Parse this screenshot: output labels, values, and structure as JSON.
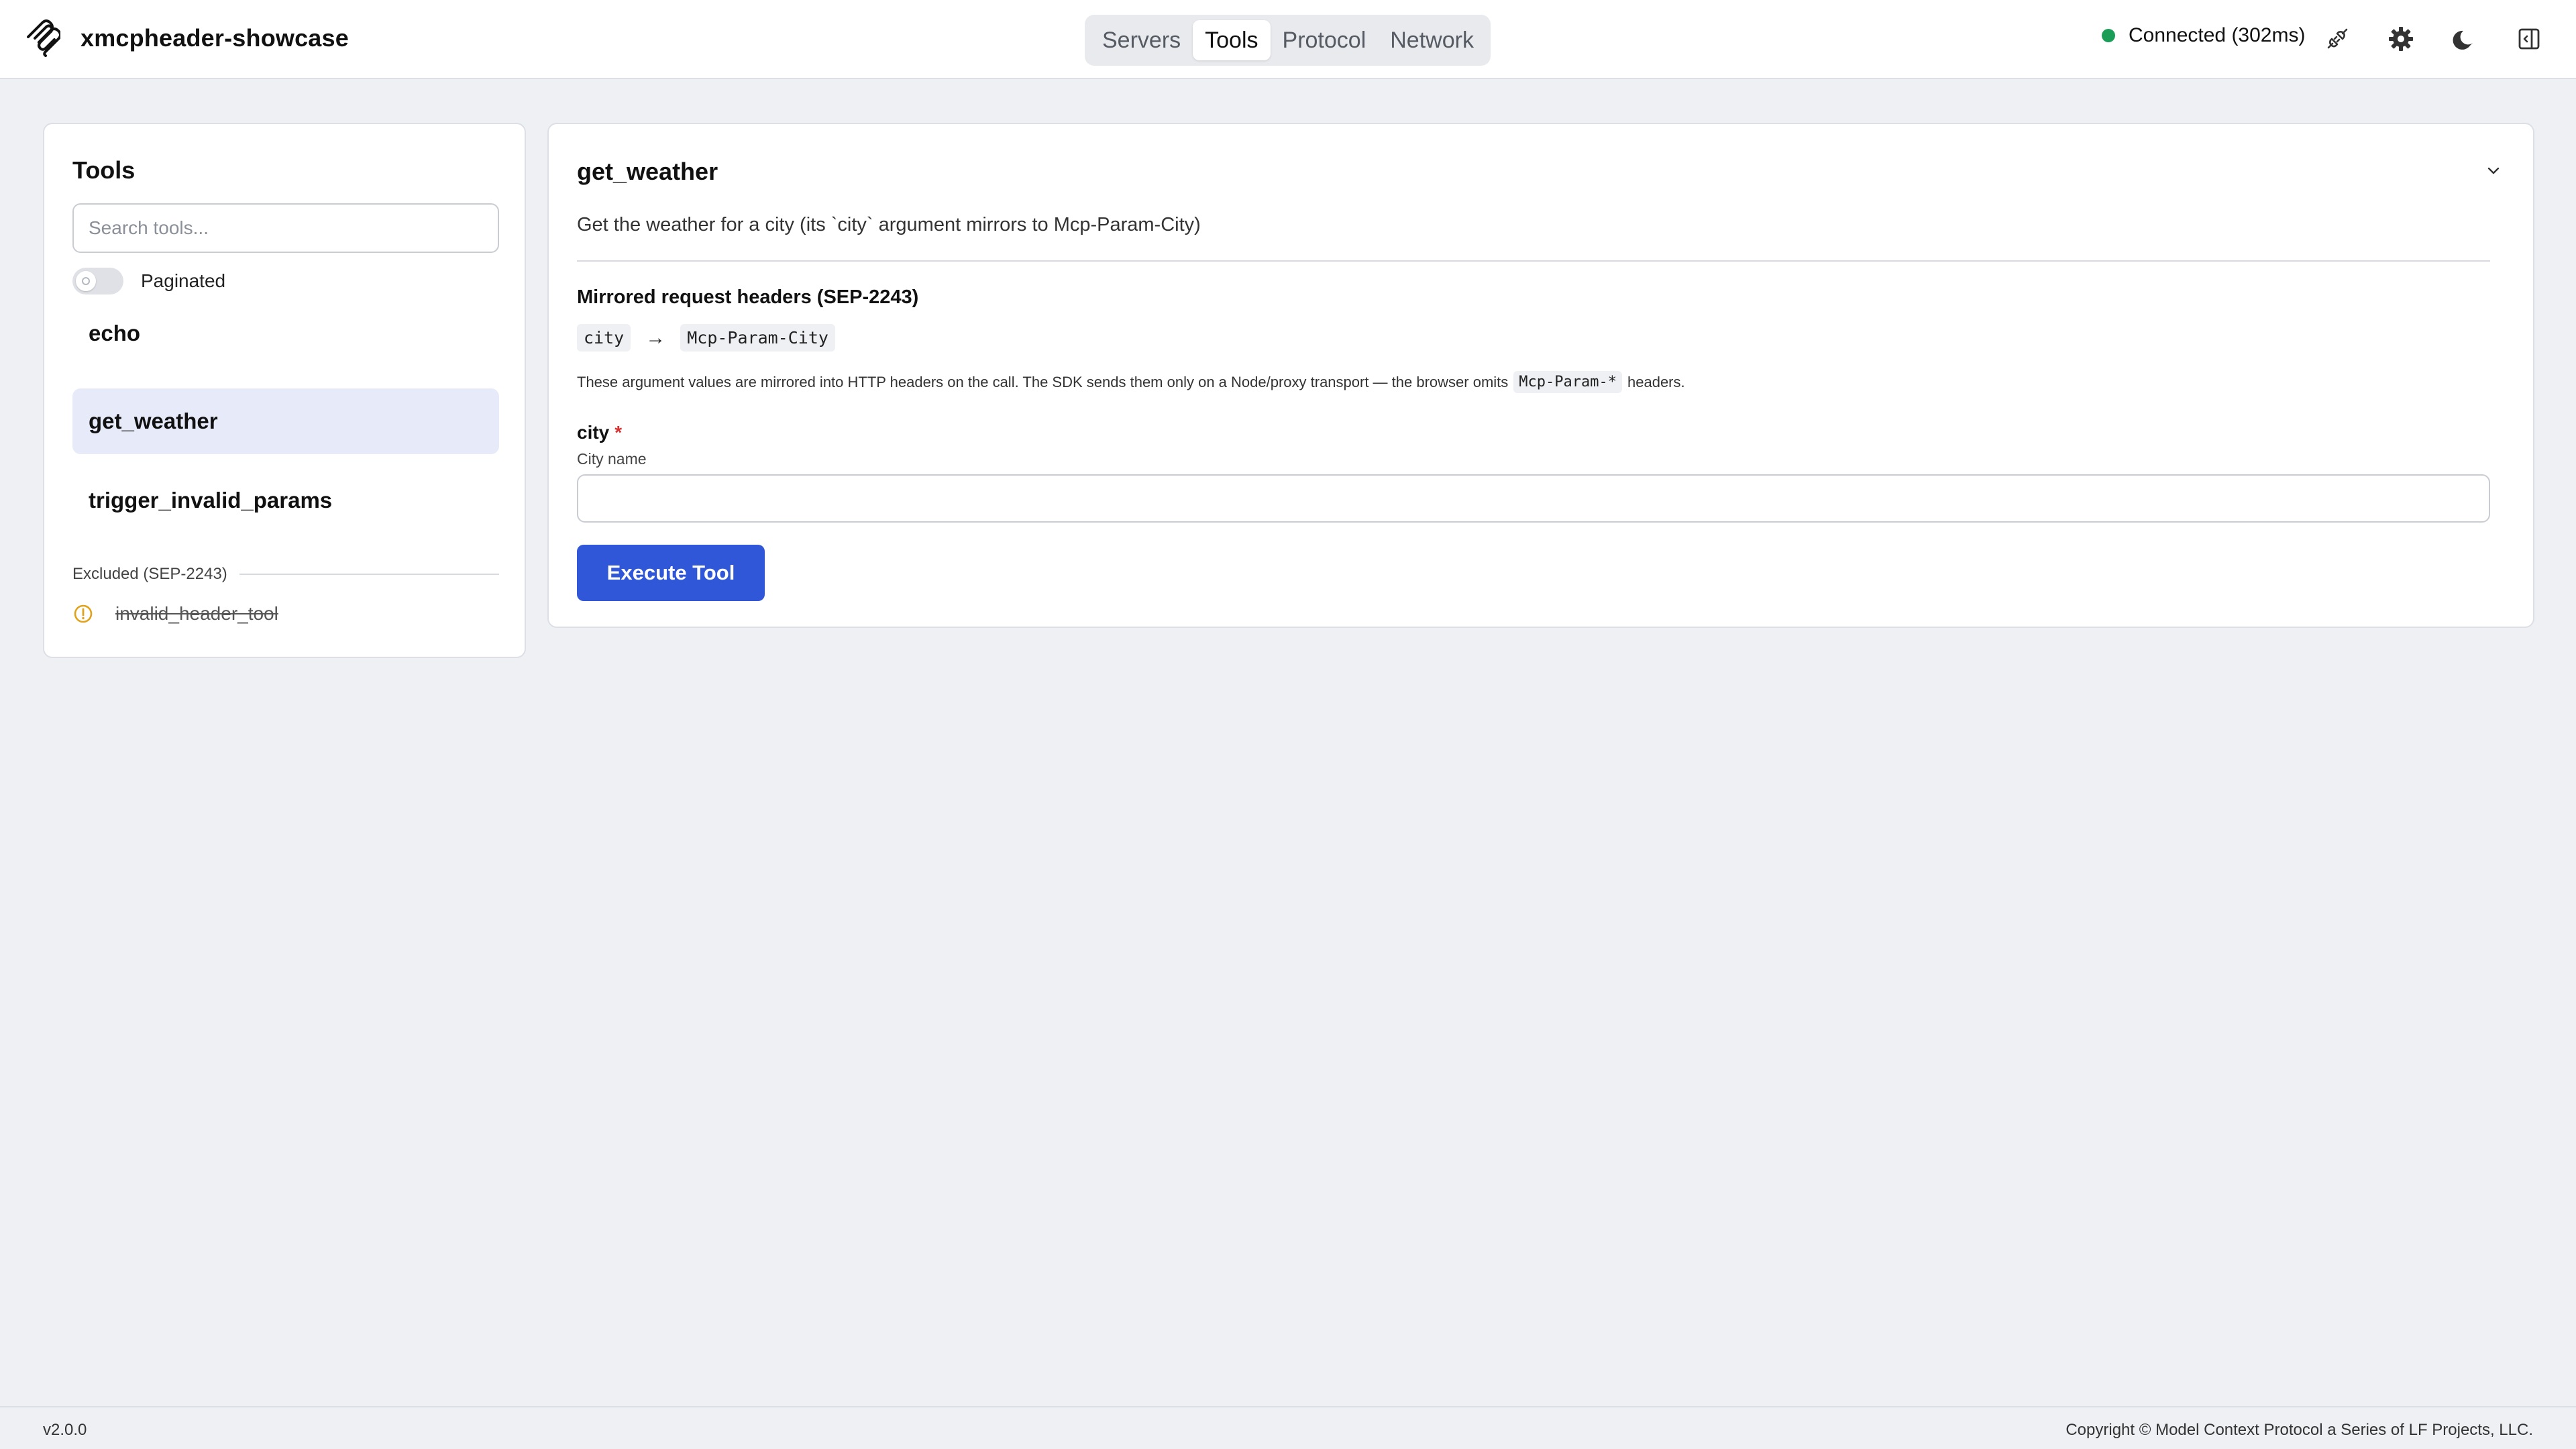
{
  "header": {
    "app_name": "xmcpheader-showcase",
    "logo_icon": "mcp-logo-icon",
    "tabs": [
      {
        "label": "Servers",
        "active": false
      },
      {
        "label": "Tools",
        "active": true
      },
      {
        "label": "Protocol",
        "active": false
      },
      {
        "label": "Network",
        "active": false
      }
    ],
    "status": {
      "text": "Connected (302ms)",
      "color": "#1a9e57"
    },
    "actions": [
      "plug-icon",
      "gear-icon",
      "moon-icon",
      "sidebar-toggle-icon"
    ]
  },
  "sidebar": {
    "title": "Tools",
    "search_placeholder": "Search tools...",
    "paginated_label": "Paginated",
    "paginated_on": false,
    "tools": [
      {
        "name": "echo",
        "selected": false
      },
      {
        "name": "get_weather",
        "selected": true
      },
      {
        "name": "trigger_invalid_params",
        "selected": false
      }
    ],
    "excluded_label": "Excluded (SEP-2243)",
    "excluded_tools": [
      {
        "name": "invalid_header_tool",
        "icon": "warning-icon"
      }
    ]
  },
  "detail": {
    "title": "get_weather",
    "description": "Get the weather for a city (its `city` argument mirrors to Mcp-Param-City)",
    "headers_section_title": "Mirrored request headers (SEP-2243)",
    "mapping": {
      "from": "city",
      "arrow": "→",
      "to": "Mcp-Param-City"
    },
    "note_prefix": "These argument values are mirrored into HTTP headers on the call. The SDK sends them only on a Node/proxy transport — the browser omits",
    "note_code": "Mcp-Param-*",
    "note_suffix": "headers.",
    "field": {
      "label": "city",
      "required_mark": "*",
      "description": "City name",
      "value": ""
    },
    "execute_label": "Execute Tool"
  },
  "footer": {
    "version": "v2.0.0",
    "copyright": "Copyright © Model Context Protocol a Series of LF Projects, LLC."
  },
  "colors": {
    "accent": "#2f57d8",
    "selected_bg": "#e7eaf8",
    "status_green": "#1a9e57",
    "warning": "#e0a21a",
    "required": "#d93030"
  }
}
